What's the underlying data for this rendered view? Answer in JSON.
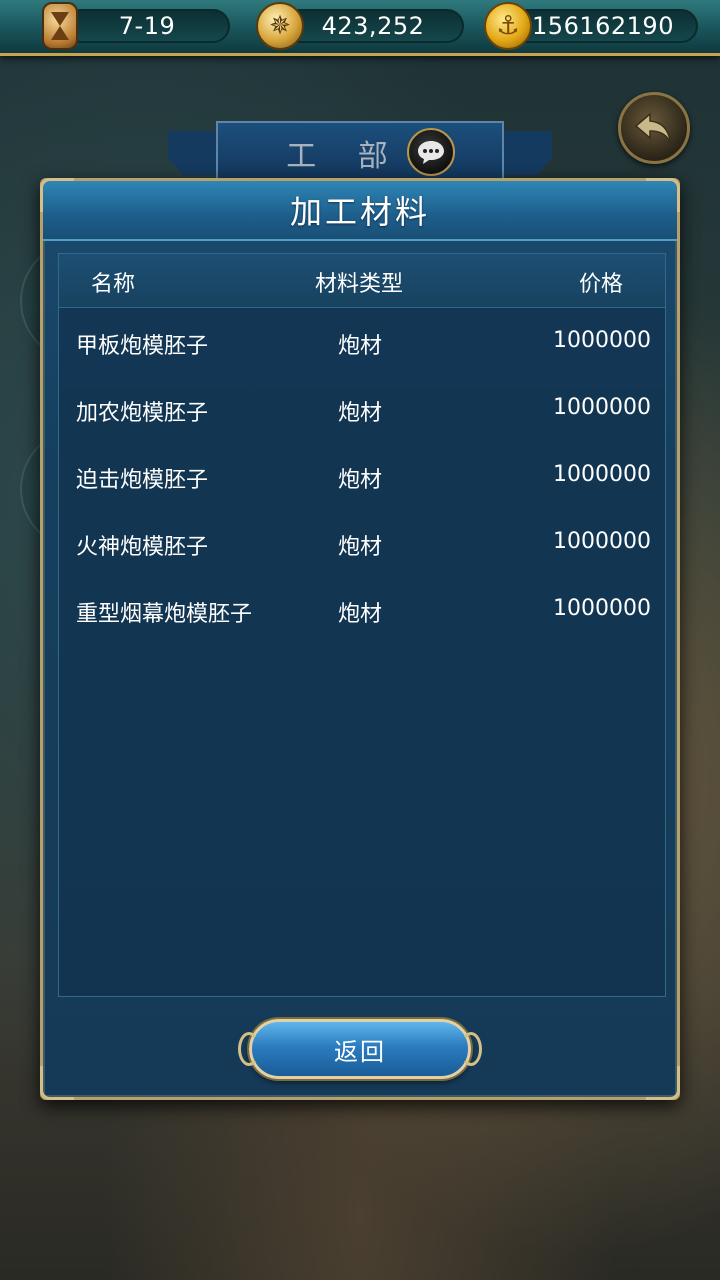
{
  "topbar": {
    "date": "7-19",
    "silver": "423,252",
    "gold": "156162190",
    "icons": [
      "hourglass-icon",
      "compass-icon",
      "anchor-coin-icon"
    ]
  },
  "header": {
    "banner_title": "工 部"
  },
  "dialog": {
    "title": "加工材料",
    "columns": {
      "name": "名称",
      "type": "材料类型",
      "price": "价格"
    },
    "rows": [
      {
        "name": "甲板炮模胚子",
        "type": "炮材",
        "price": "1000000"
      },
      {
        "name": "加农炮模胚子",
        "type": "炮材",
        "price": "1000000"
      },
      {
        "name": "迫击炮模胚子",
        "type": "炮材",
        "price": "1000000"
      },
      {
        "name": "火神炮模胚子",
        "type": "炮材",
        "price": "1000000"
      },
      {
        "name": "重型烟幕炮模胚子",
        "type": "炮材",
        "price": "1000000"
      }
    ],
    "return_label": "返回"
  },
  "colors": {
    "accent_gold": "#c9a34e",
    "dialog_blue": "#1b4b6e",
    "button_blue": "#2b7cc0"
  }
}
